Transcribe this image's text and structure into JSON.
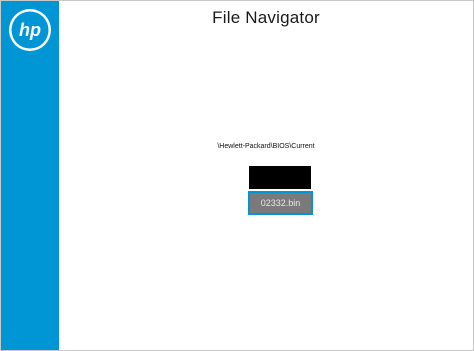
{
  "app": {
    "title": "File Navigator",
    "logo_text": "hp",
    "brand_color": "#0096d6"
  },
  "navigator": {
    "current_path": "\\Hewlett-Packard\\BIOS\\Current",
    "items": [
      {
        "label": ""
      },
      {
        "label": "02332.bin",
        "selected": true
      }
    ]
  }
}
